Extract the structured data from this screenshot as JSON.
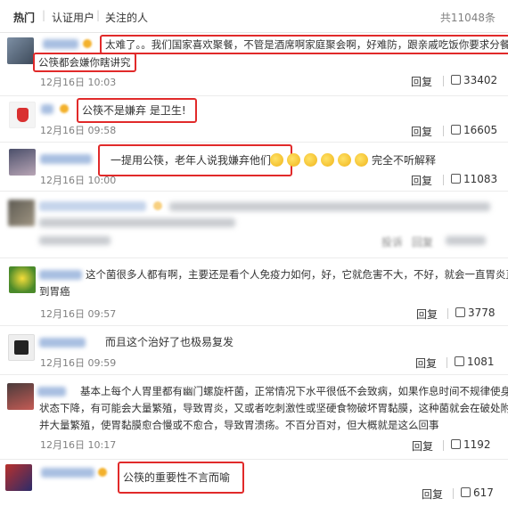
{
  "header": {
    "tabs": [
      "热门",
      "认证用户",
      "关注的人"
    ],
    "total": "共11048条"
  },
  "actions": {
    "reply_label": "回复"
  },
  "comments": [
    {
      "text_line1": "太难了。。我们国家喜欢聚餐，不管是酒席啊家庭聚会啊，好难防，跟亲戚吃饭你要求分餐",
      "text_line2": "公筷都会嫌你瞎讲究",
      "time": "12月16日 10:03",
      "likes": "33402"
    },
    {
      "text": "公筷不是嫌弃 是卫生!",
      "time": "12月16日 09:58",
      "likes": "16605"
    },
    {
      "text": "一提用公筷，老年人说我嫌弃他们呢",
      "suffix": "完全不听解释",
      "emoji": "emoji-smile",
      "time": "12月16日 10:00",
      "likes": "11083"
    },
    {
      "blurred": true,
      "reply_label": "回复",
      "reply_tag": "投诉"
    },
    {
      "text_line1": "这个菌很多人都有啊，主要还是看个人免疫力如何，好，它就危害不大，不好，就会一直胃炎直",
      "text_line2": "到胃癌",
      "time": "12月16日 09:57",
      "likes": "3778"
    },
    {
      "text": "而且这个治好了也极易复发",
      "time": "12月16日 09:59",
      "likes": "1081"
    },
    {
      "text_line1": "基本上每个人胃里都有幽门螺旋杆菌，正常情况下水平很低不会致病，如果作息时间不规律使身体",
      "text_line2": "状态下降，有可能会大量繁殖，导致胃炎，又或者吃刺激性或坚硬食物破坏胃黏膜，这种菌就会在破处附着",
      "text_line3": "并大量繁殖，使胃黏膜愈合慢或不愈合，导致胃溃疡。不百分百对，但大概就是这么回事",
      "time": "12月16日 10:17",
      "likes": "1192"
    },
    {
      "text": "公筷的重要性不言而喻",
      "likes": "617"
    }
  ],
  "colors": {
    "highlight": "#e12a2a",
    "link": "#9fb8de",
    "muted": "#808080"
  }
}
